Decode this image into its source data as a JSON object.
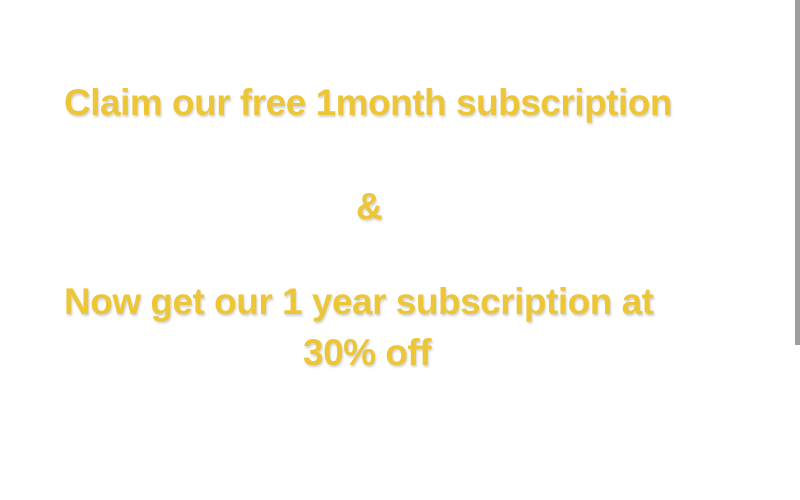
{
  "promo": {
    "line1": "Claim our free 1month subscription",
    "ampersand": "&",
    "line2": "Now get our 1 year subscription at",
    "line3": "30% off"
  },
  "colors": {
    "text": "#ecc636",
    "background": "#ffffff",
    "scroll_edge": "#9e9e9e"
  }
}
